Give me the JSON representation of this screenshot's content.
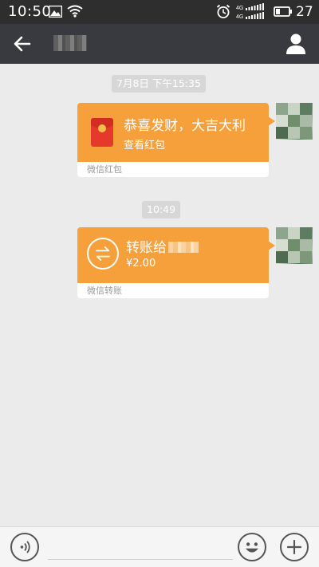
{
  "status_bar": {
    "time": "10:50",
    "battery": "27",
    "network": "4G"
  },
  "header": {
    "icons": {
      "back": "back-arrow-icon",
      "profile": "person-icon"
    }
  },
  "messages": [
    {
      "timestamp": "7月8日 下午15:35",
      "type": "red_packet",
      "title": "恭喜发财，大吉大利",
      "subtitle": "查看红包",
      "footer": "微信红包"
    },
    {
      "timestamp": "10:49",
      "type": "transfer",
      "title": "转账给",
      "amount": "¥2.00",
      "footer": "微信转账"
    }
  ],
  "input_bar": {
    "icons": [
      "voice-icon",
      "emoji-icon",
      "plus-icon"
    ]
  },
  "colors": {
    "status_bar": "#2e2e2e",
    "header": "#393a3f",
    "card": "#f6a03b",
    "background": "#ebebeb"
  }
}
